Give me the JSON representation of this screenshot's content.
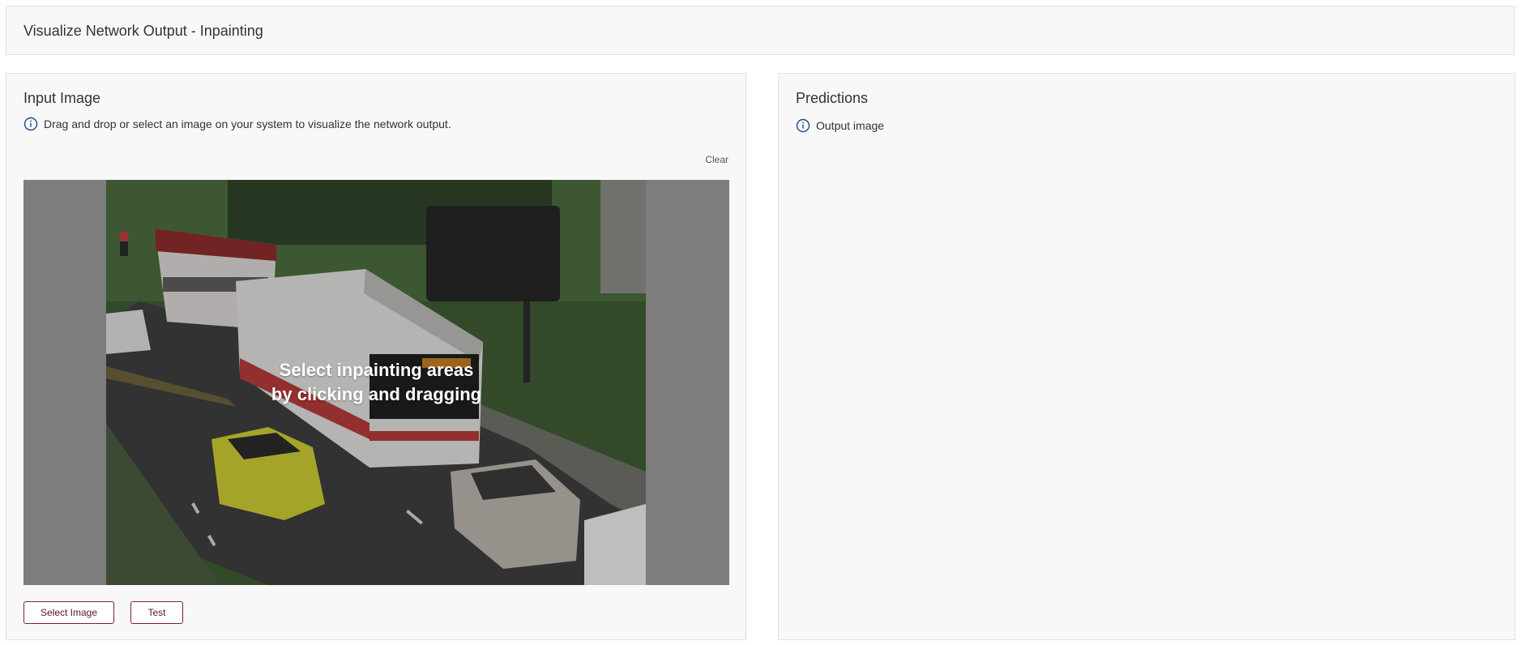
{
  "header": {
    "title": "Visualize Network Output - Inpainting"
  },
  "input_panel": {
    "title": "Input Image",
    "info_text": "Drag and drop or select an image on your system to visualize the network output.",
    "clear_label": "Clear",
    "overlay_text": "Select inpainting areas\nby clicking and dragging",
    "select_image_label": "Select Image",
    "test_label": "Test"
  },
  "predictions_panel": {
    "title": "Predictions",
    "info_text": "Output image"
  },
  "colors": {
    "panel_bg": "#f8f8f8",
    "border": "#e1e1e1",
    "button_border": "#7a1f3d",
    "info_icon": "#1a4a8a",
    "image_backdrop": "#7d7d7d"
  },
  "icons": {
    "info": "info-circle-icon"
  }
}
